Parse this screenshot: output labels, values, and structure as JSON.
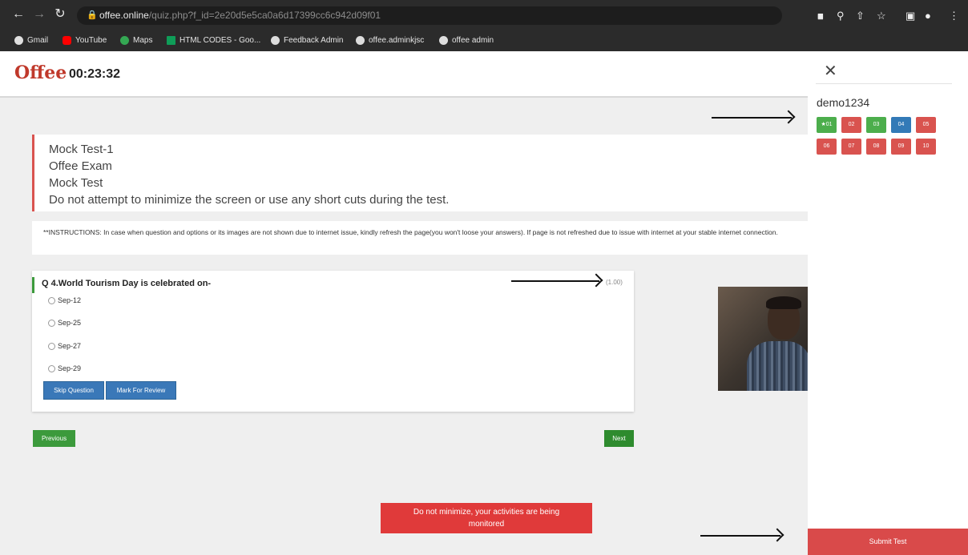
{
  "browser": {
    "url_host": "offee.online",
    "url_path": "/quiz.php?f_id=2e20d5e5ca0a6d17399cc6c942d09f01",
    "bookmarks": [
      {
        "label": "Gmail",
        "color": "#ea4335"
      },
      {
        "label": "YouTube",
        "color": "#ff0000"
      },
      {
        "label": "Maps",
        "color": "#34a853"
      },
      {
        "label": "HTML CODES - Goo...",
        "color": "#0f9d58"
      },
      {
        "label": "Feedback Admin",
        "color": "#ffffff"
      },
      {
        "label": "offee.adminkjsc",
        "color": "#ffffff"
      },
      {
        "label": "offee admin",
        "color": "#ffffff"
      }
    ]
  },
  "header": {
    "logo": "Offee",
    "timer": "00:23:32"
  },
  "info": {
    "lines": [
      "Mock Test-1",
      "Offee Exam",
      "Mock Test",
      "Do not attempt to minimize the screen or use any short cuts during the test."
    ]
  },
  "instructions": "**INSTRUCTIONS: In case when question and options or its images are not shown due to internet issue, kindly refresh the page(you won't loose your answers). If page is not refreshed due to issue with internet at your stable internet connection.",
  "question": {
    "text": "Q 4.World Tourism Day is celebrated on-",
    "marks": "(1.00)",
    "options": [
      "Sep-12",
      "Sep-25",
      "Sep-27",
      "Sep-29"
    ],
    "skip_label": "Skip Question",
    "review_label": "Mark For Review"
  },
  "nav": {
    "previous": "Previous",
    "next": "Next"
  },
  "warning": {
    "line1": "Do not minimize, your activities are being",
    "line2": "monitored"
  },
  "sidebar": {
    "username": "demo1234",
    "questions": [
      {
        "label": "★01",
        "status": "answered",
        "color": "#4cae4c"
      },
      {
        "label": "02",
        "status": "not-answered",
        "color": "#d9534f"
      },
      {
        "label": "03",
        "status": "answered",
        "color": "#4cae4c"
      },
      {
        "label": "04",
        "status": "current",
        "color": "#337ab7"
      },
      {
        "label": "05",
        "status": "not-answered",
        "color": "#d9534f"
      },
      {
        "label": "06",
        "status": "not-answered",
        "color": "#d9534f"
      },
      {
        "label": "07",
        "status": "not-answered",
        "color": "#d9534f"
      },
      {
        "label": "08",
        "status": "not-answered",
        "color": "#d9534f"
      },
      {
        "label": "09",
        "status": "not-answered",
        "color": "#d9534f"
      },
      {
        "label": "10",
        "status": "not-answered",
        "color": "#d9534f"
      }
    ],
    "submit_label": "Submit Test"
  }
}
